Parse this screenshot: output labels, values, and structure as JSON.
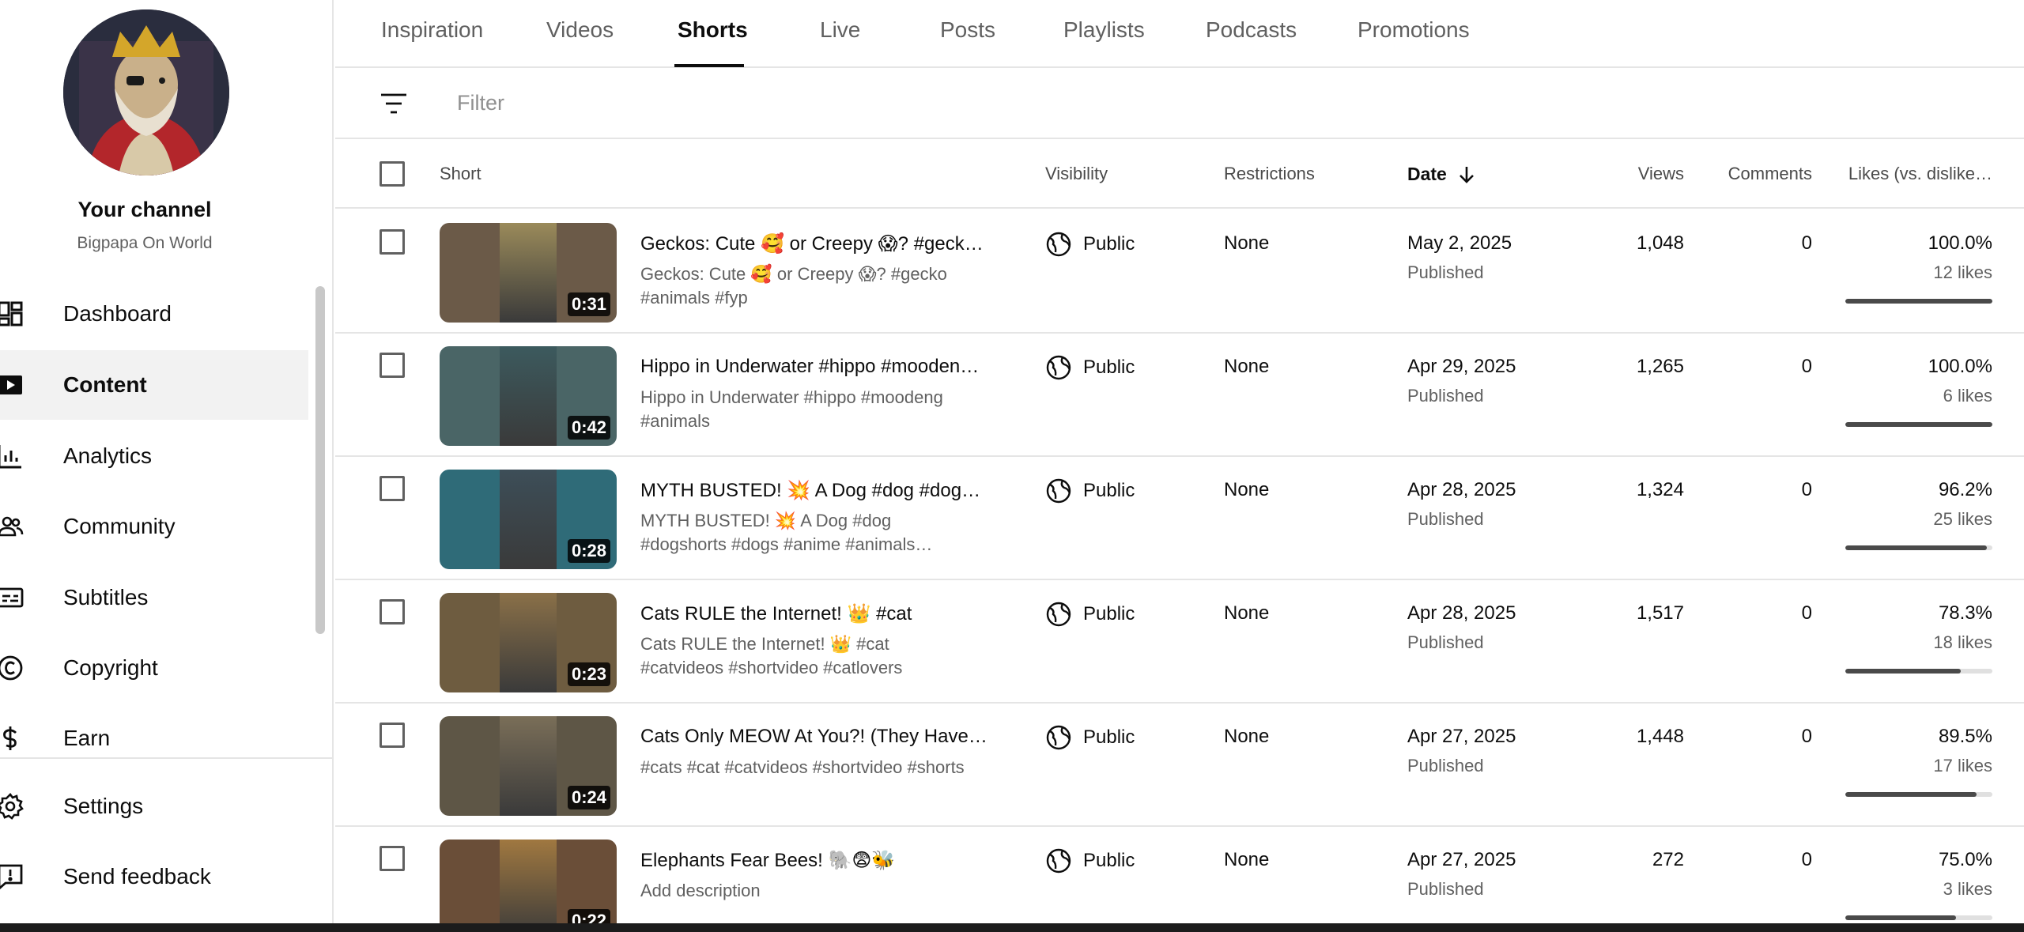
{
  "channel": {
    "title": "Your channel",
    "name": "Bigpapa On World"
  },
  "nav": [
    {
      "label": "Dashboard",
      "icon": "dashboard-icon"
    },
    {
      "label": "Content",
      "icon": "content-icon",
      "active": true
    },
    {
      "label": "Analytics",
      "icon": "analytics-icon"
    },
    {
      "label": "Community",
      "icon": "community-icon"
    },
    {
      "label": "Subtitles",
      "icon": "subtitles-icon"
    },
    {
      "label": "Copyright",
      "icon": "copyright-icon"
    },
    {
      "label": "Earn",
      "icon": "dollar-icon"
    },
    {
      "label": "Settings",
      "icon": "gear-icon"
    },
    {
      "label": "Send feedback",
      "icon": "feedback-icon"
    }
  ],
  "tabs": [
    "Inspiration",
    "Videos",
    "Shorts",
    "Live",
    "Posts",
    "Playlists",
    "Podcasts",
    "Promotions"
  ],
  "active_tab": "Shorts",
  "filter": {
    "placeholder": "Filter"
  },
  "columns": {
    "short": "Short",
    "visibility": "Visibility",
    "restrictions": "Restrictions",
    "date": "Date",
    "views": "Views",
    "comments": "Comments",
    "likes": "Likes (vs. dislike…"
  },
  "rows": [
    {
      "title": "Geckos: Cute 🥰 or Creepy 😱? #geck…",
      "desc": "Geckos: Cute 🥰 or Creepy 😱? #gecko #animals #fyp",
      "duration": "0:31",
      "visibility": "Public",
      "restrictions": "None",
      "date": "May 2, 2025",
      "status": "Published",
      "views": "1,048",
      "comments": "0",
      "likes_pct": "100.0%",
      "likes": "12 likes",
      "likes_ratio": 1.0,
      "thumb_color": "#6b5a48",
      "inner_color": "#9a8a5a"
    },
    {
      "title": "Hippo in Underwater #hippo #mooden…",
      "desc": "Hippo in Underwater #hippo #moodeng #animals",
      "duration": "0:42",
      "visibility": "Public",
      "restrictions": "None",
      "date": "Apr 29, 2025",
      "status": "Published",
      "views": "1,265",
      "comments": "0",
      "likes_pct": "100.0%",
      "likes": "6 likes",
      "likes_ratio": 1.0,
      "thumb_color": "#4a6566",
      "inner_color": "#3c5a5e"
    },
    {
      "title": "MYTH BUSTED! 💥 A Dog #dog #dogs…",
      "desc": "MYTH BUSTED! 💥 A Dog #dog #dogshorts #dogs #anime #animals…",
      "duration": "0:28",
      "visibility": "Public",
      "restrictions": "None",
      "date": "Apr 28, 2025",
      "status": "Published",
      "views": "1,324",
      "comments": "0",
      "likes_pct": "96.2%",
      "likes": "25 likes",
      "likes_ratio": 0.962,
      "thumb_color": "#2f6b78",
      "inner_color": "#3d4e58"
    },
    {
      "title": "Cats RULE the Internet! 👑 #cat",
      "desc": "Cats RULE the Internet! 👑 #cat #catvideos #shortvideo #catlovers",
      "duration": "0:23",
      "visibility": "Public",
      "restrictions": "None",
      "date": "Apr 28, 2025",
      "status": "Published",
      "views": "1,517",
      "comments": "0",
      "likes_pct": "78.3%",
      "likes": "18 likes",
      "likes_ratio": 0.783,
      "thumb_color": "#6e5c40",
      "inner_color": "#8a7048"
    },
    {
      "title": "Cats Only MEOW At You?! (They Have …",
      "desc": "#cats #cat #catvideos #shortvideo #shorts",
      "duration": "0:24",
      "visibility": "Public",
      "restrictions": "None",
      "date": "Apr 27, 2025",
      "status": "Published",
      "views": "1,448",
      "comments": "0",
      "likes_pct": "89.5%",
      "likes": "17 likes",
      "likes_ratio": 0.895,
      "thumb_color": "#5e5646",
      "inner_color": "#7a6e58"
    },
    {
      "title": "Elephants Fear Bees! 🐘😨🐝",
      "desc": "Add description",
      "duration": "0:22",
      "visibility": "Public",
      "restrictions": "None",
      "date": "Apr 27, 2025",
      "status": "Published",
      "views": "272",
      "comments": "0",
      "likes_pct": "75.0%",
      "likes": "3 likes",
      "likes_ratio": 0.75,
      "thumb_color": "#6a4e38",
      "inner_color": "#a07840"
    }
  ]
}
